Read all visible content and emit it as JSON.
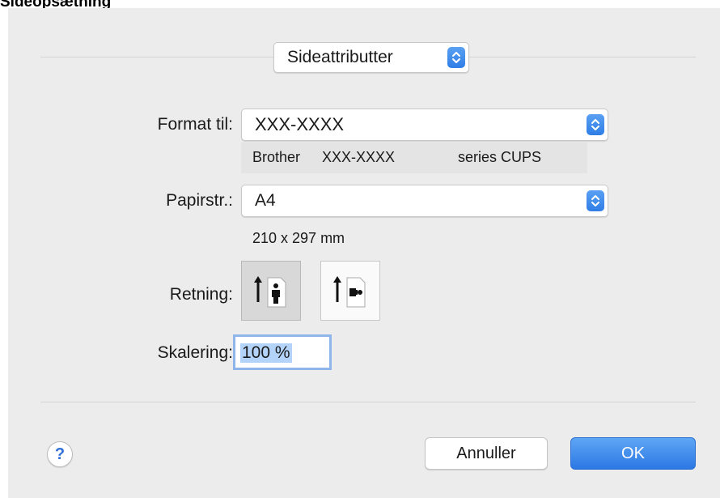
{
  "window_title": "Sideopsætning",
  "header": {
    "settings_popup": "Sideattributter"
  },
  "format_for": {
    "label": "Format til:",
    "value": "XXX-XXXX",
    "description_name": "Brother",
    "description_model": "XXX-XXXX",
    "description_suffix": "series CUPS"
  },
  "paper_size": {
    "label": "Papirstr.:",
    "value": "A4",
    "dimensions": "210 x 297 mm"
  },
  "orientation": {
    "label": "Retning:",
    "selected": "portrait",
    "options": [
      "portrait",
      "landscape"
    ]
  },
  "scaling": {
    "label": "Skalering:",
    "value": "100 %"
  },
  "buttons": {
    "help": "?",
    "cancel": "Annuller",
    "ok": "OK"
  },
  "colors": {
    "accent": "#2f7de6",
    "dialog_bg": "#ececec",
    "focus_ring": "#8fb5ea",
    "selection": "#b3d3f9"
  },
  "icons": [
    "up-down-chevron-icon",
    "portrait-orientation-icon",
    "landscape-orientation-icon",
    "help-icon"
  ]
}
